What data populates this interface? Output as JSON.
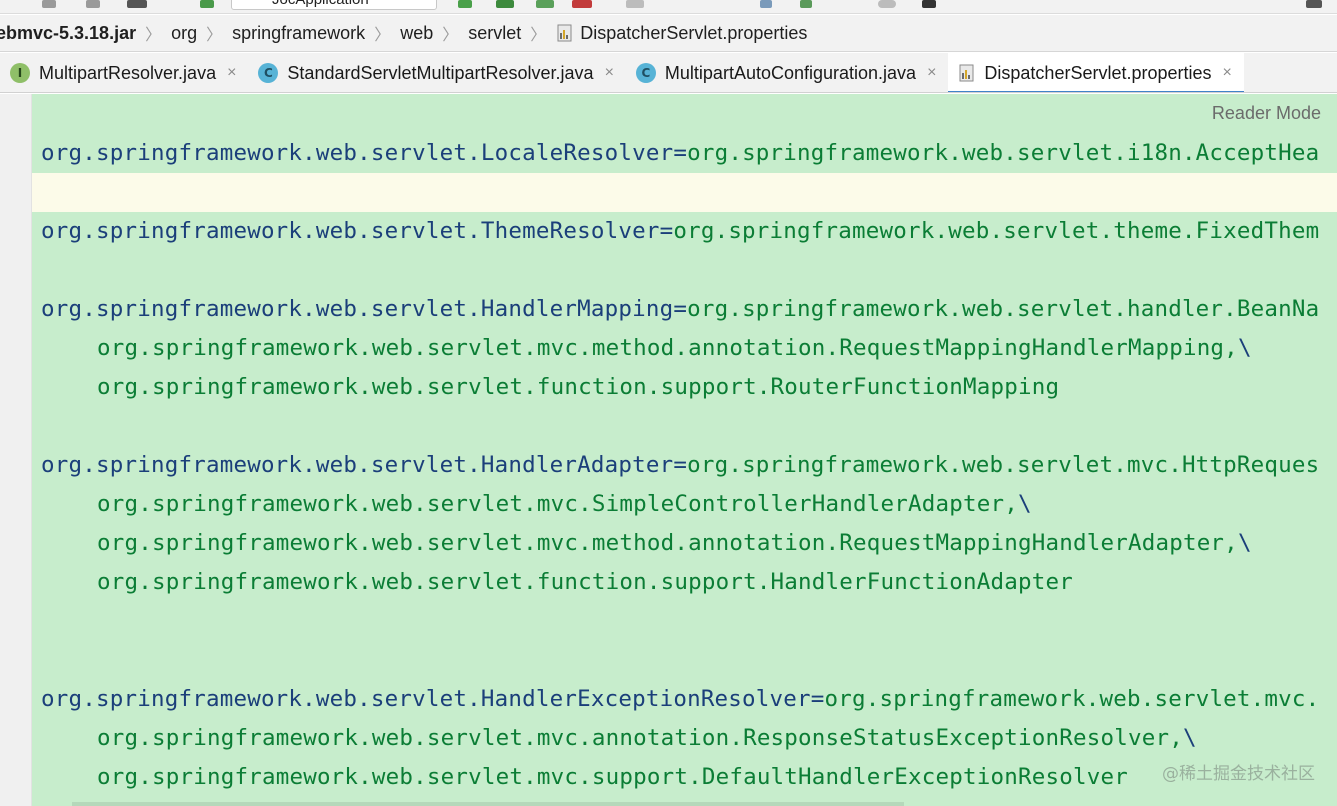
{
  "toolbar": {
    "run_config": "JocApplication"
  },
  "breadcrumb": {
    "items": [
      "ebmvc-5.3.18.jar",
      "org",
      "springframework",
      "web",
      "servlet",
      "DispatcherServlet.properties"
    ],
    "separator": "〉"
  },
  "tabs": [
    {
      "label": "MultipartResolver.java",
      "icon": "interface-icon",
      "icon_letter": "I",
      "close": "×"
    },
    {
      "label": "StandardServletMultipartResolver.java",
      "icon": "class-icon",
      "icon_letter": "C",
      "close": "×"
    },
    {
      "label": "MultipartAutoConfiguration.java",
      "icon": "class-icon",
      "icon_letter": "C",
      "close": "×"
    },
    {
      "label": "DispatcherServlet.properties",
      "icon": "properties-file-icon",
      "icon_letter": "",
      "close": "×"
    }
  ],
  "editor": {
    "reader_mode": "Reader Mode",
    "lines": [
      {
        "key": "org.springframework.web.servlet.LocaleResolver",
        "eq": "=",
        "val": "org.springframework.web.servlet.i18n.AcceptHea",
        "cont": ""
      },
      {
        "key": "",
        "eq": "",
        "val": "",
        "cont": ""
      },
      {
        "key": "org.springframework.web.servlet.ThemeResolver",
        "eq": "=",
        "val": "org.springframework.web.servlet.theme.FixedThem",
        "cont": ""
      },
      {
        "key": "",
        "eq": "",
        "val": "",
        "cont": ""
      },
      {
        "key": "org.springframework.web.servlet.HandlerMapping",
        "eq": "=",
        "val": "org.springframework.web.servlet.handler.BeanNa",
        "cont": ""
      },
      {
        "key": "",
        "eq": "",
        "val": "org.springframework.web.servlet.mvc.method.annotation.RequestMappingHandlerMapping,",
        "cont": "\\"
      },
      {
        "key": "",
        "eq": "",
        "val": "org.springframework.web.servlet.function.support.RouterFunctionMapping",
        "cont": ""
      },
      {
        "key": "",
        "eq": "",
        "val": "",
        "cont": ""
      },
      {
        "key": "org.springframework.web.servlet.HandlerAdapter",
        "eq": "=",
        "val": "org.springframework.web.servlet.mvc.HttpReques",
        "cont": ""
      },
      {
        "key": "",
        "eq": "",
        "val": "org.springframework.web.servlet.mvc.SimpleControllerHandlerAdapter,",
        "cont": "\\"
      },
      {
        "key": "",
        "eq": "",
        "val": "org.springframework.web.servlet.mvc.method.annotation.RequestMappingHandlerAdapter,",
        "cont": "\\"
      },
      {
        "key": "",
        "eq": "",
        "val": "org.springframework.web.servlet.function.support.HandlerFunctionAdapter",
        "cont": ""
      },
      {
        "key": "",
        "eq": "",
        "val": "",
        "cont": ""
      },
      {
        "key": "",
        "eq": "",
        "val": "",
        "cont": ""
      },
      {
        "key": "org.springframework.web.servlet.HandlerExceptionResolver",
        "eq": "=",
        "val": "org.springframework.web.servlet.mvc.",
        "cont": ""
      },
      {
        "key": "",
        "eq": "",
        "val": "org.springframework.web.servlet.mvc.annotation.ResponseStatusExceptionResolver,",
        "cont": "\\"
      },
      {
        "key": "",
        "eq": "",
        "val": "org.springframework.web.servlet.mvc.support.DefaultHandlerExceptionResolver",
        "cont": ""
      }
    ]
  },
  "watermark": "@稀土掘金技术社区",
  "colors": {
    "editor_bg": "#c7edcc",
    "key": "#1b3f7a",
    "value": "#0b7d35",
    "current_line": "#fcfbe9",
    "tab_underline": "#4083c9"
  }
}
